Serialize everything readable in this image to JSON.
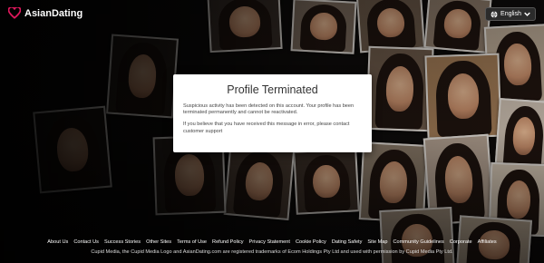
{
  "brand": {
    "name": "AsianDating"
  },
  "language": {
    "label": "English"
  },
  "modal": {
    "title": "Profile Terminated",
    "message": "Suspicious activity has been detected on this account. Your profile has been terminated permanently and cannot be reactivated.",
    "contact_prefix": "If you believe that you have received this message in error, please ",
    "contact_link": "contact customer support"
  },
  "footer": {
    "links": [
      "About Us",
      "Contact Us",
      "Success Stories",
      "Other Sites",
      "Terms of Use",
      "Refund Policy",
      "Privacy Statement",
      "Cookie Policy",
      "Dating Safety",
      "Site Map",
      "Community Guidelines",
      "Corporate",
      "Affiliates"
    ],
    "trademark": "Cupid Media, the Cupid Media Logo and AsianDating.com are registered trademarks of Ecom Holdings Pty Ltd and used with permission by Cupid Media Pty Ltd."
  },
  "colors": {
    "logo_heart": "#e0185d",
    "modal_bg": "#ffffff",
    "page_bg": "#0e0c0b"
  }
}
